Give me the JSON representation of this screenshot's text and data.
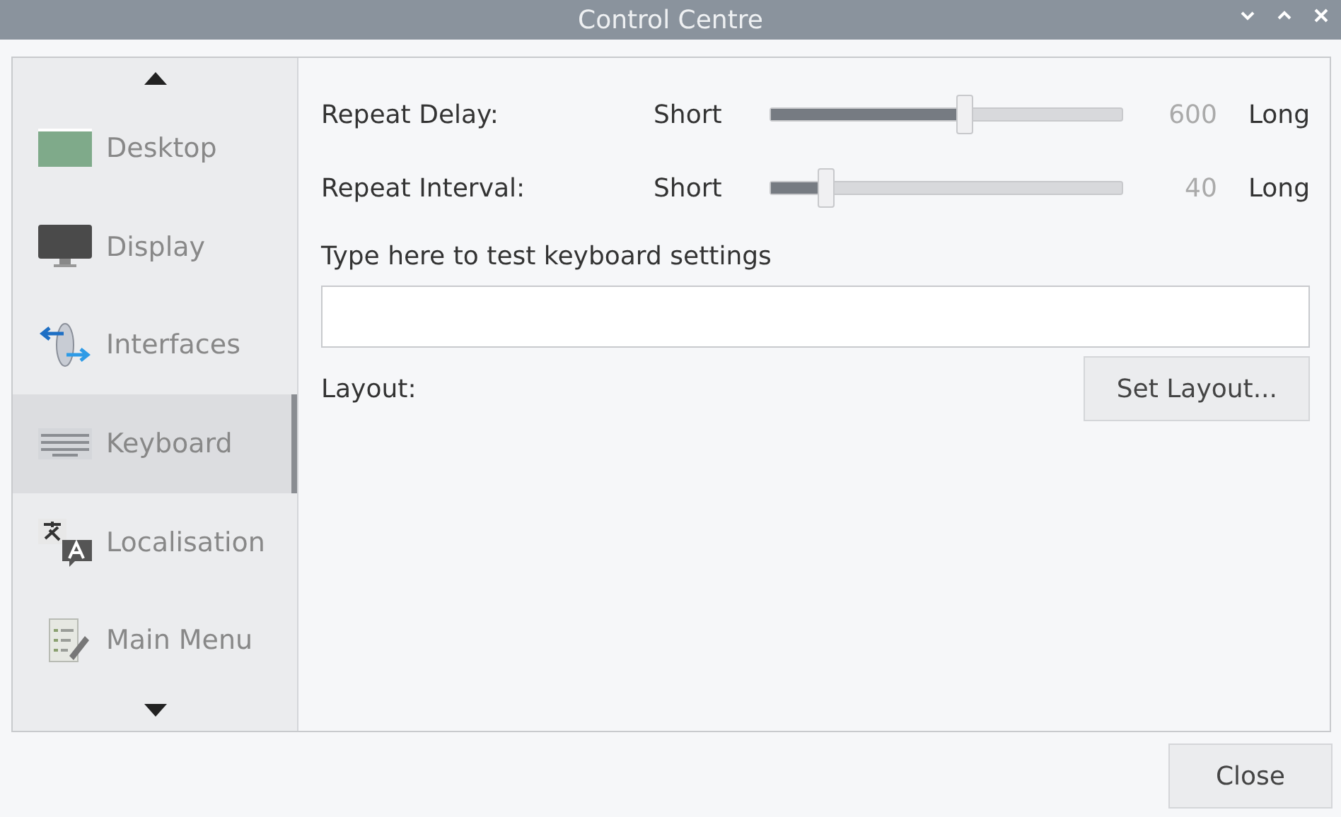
{
  "window": {
    "title": "Control Centre"
  },
  "sidebar": {
    "items": [
      {
        "label": "Desktop",
        "kind": "desktop",
        "selected": false
      },
      {
        "label": "Display",
        "kind": "display",
        "selected": false
      },
      {
        "label": "Interfaces",
        "kind": "interfaces",
        "selected": false
      },
      {
        "label": "Keyboard",
        "kind": "keyboard",
        "selected": true
      },
      {
        "label": "Localisation",
        "kind": "localisation",
        "selected": false
      },
      {
        "label": "Main Menu",
        "kind": "menu",
        "selected": false
      }
    ]
  },
  "sliders": [
    {
      "label": "Repeat Delay:",
      "min_label": "Short",
      "level": 0.55,
      "reading": "600",
      "max_label": "Long"
    },
    {
      "label": "Repeat Interval:",
      "min_label": "Short",
      "level": 0.16,
      "reading": "40",
      "max_label": "Long"
    }
  ],
  "test_field": {
    "label": "Type here to test keyboard settings"
  },
  "layout": {
    "label": "Layout:",
    "button": "Set Layout..."
  },
  "buttons": [
    "Close"
  ]
}
